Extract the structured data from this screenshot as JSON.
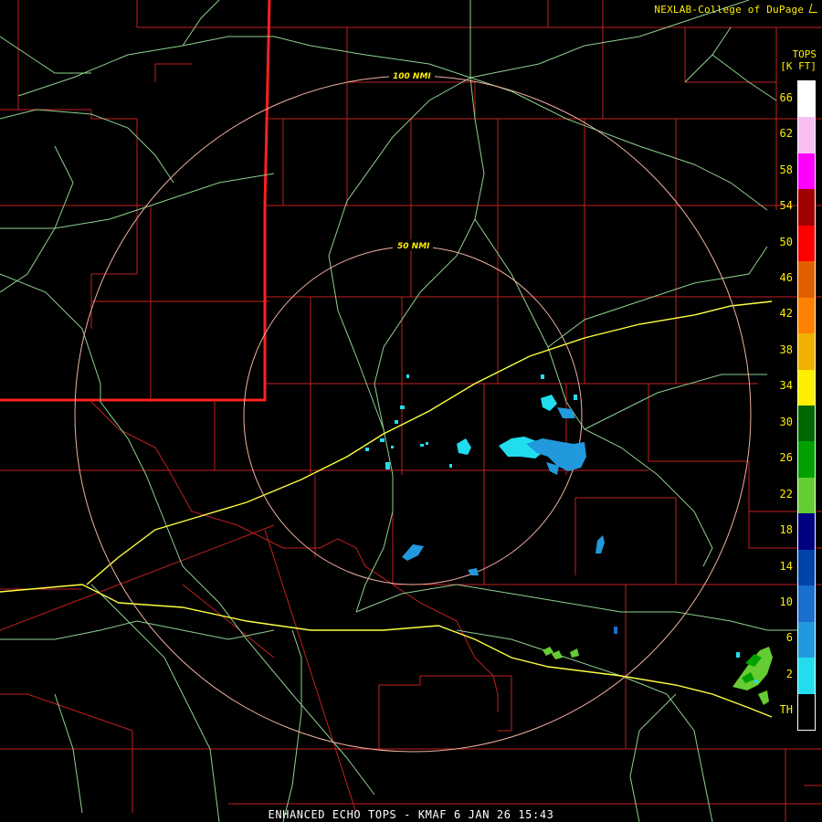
{
  "credit": "NEXLAB-College of DuPage",
  "legend": {
    "title_line1": "TOPS",
    "title_line2": "[K FT]",
    "labels": [
      "66",
      "62",
      "58",
      "54",
      "50",
      "46",
      "42",
      "38",
      "34",
      "30",
      "26",
      "22",
      "18",
      "14",
      "10",
      "6",
      "2",
      "TH"
    ],
    "colors": [
      "#ffffff",
      "#f7c0f0",
      "#ff00ff",
      "#a00000",
      "#ff0000",
      "#e06000",
      "#ff8000",
      "#f0b000",
      "#ffee00",
      "#006600",
      "#00a000",
      "#66cc33",
      "#000080",
      "#0044aa",
      "#1a6ecc",
      "#2299dd",
      "#22ddee",
      "#000000"
    ]
  },
  "rings": {
    "inner_label": "50 NMI",
    "outer_label": "100 NMI"
  },
  "footer": "ENHANCED ECHO TOPS - KMAF 6 JAN 26 15:43",
  "colors": {
    "counties": "#c02020",
    "state_border": "#ff2020",
    "roads": "#8ed08e",
    "highways": "#ffff40",
    "rings": "#f0b0a0"
  }
}
